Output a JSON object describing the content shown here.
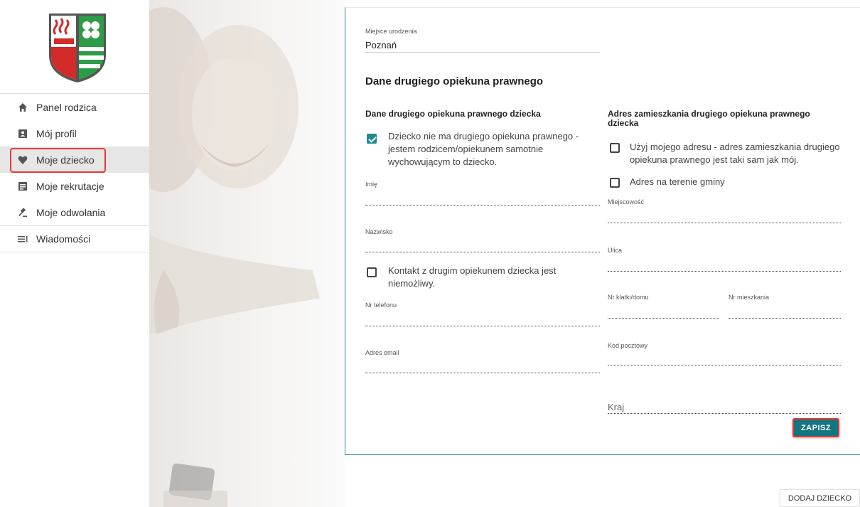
{
  "nav": {
    "items": [
      {
        "label": "Panel rodzica",
        "icon": "home-icon"
      },
      {
        "label": "Mój profil",
        "icon": "id-card-icon"
      },
      {
        "label": "Moje dziecko",
        "icon": "heart-icon"
      },
      {
        "label": "Moje rekrutacje",
        "icon": "document-icon"
      },
      {
        "label": "Moje odwołania",
        "icon": "gavel-icon"
      },
      {
        "label": "Wiadomości",
        "icon": "messages-icon"
      }
    ],
    "active_index": 2
  },
  "form": {
    "birth_place": {
      "label": "Miejsce urodzenia",
      "value": "Poznań"
    },
    "section_title": "Dane drugiego opiekuna prawnego",
    "left": {
      "title": "Dane drugiego opiekuna prawnego dziecka",
      "no_guardian_checkbox": {
        "label": "Dziecko nie ma drugiego opiekuna prawnego - jestem rodzicem/opiekunem samotnie wychowującym to dziecko.",
        "checked": true
      },
      "first_name_label": "Imię",
      "last_name_label": "Nazwisko",
      "no_contact_checkbox": {
        "label": "Kontakt z drugim opiekunem dziecka jest niemożliwy.",
        "checked": false
      },
      "phone_label": "Nr telefonu",
      "email_label": "Adres email"
    },
    "right": {
      "title": "Adres zamieszkania drugiego opiekuna prawnego dziecka",
      "same_address_checkbox": {
        "label": "Użyj mojego adresu - adres zamieszkania drugiego opiekuna prawnego jest taki sam jak mój.",
        "checked": false
      },
      "in_commune_checkbox": {
        "label": "Adres na terenie gminy",
        "checked": false
      },
      "city_label": "Miejscowość",
      "street_label": "Ulica",
      "building_label": "Nr klatki/domu",
      "flat_label": "Nr mieszkania",
      "postal_label": "Kod pocztowy",
      "country_label": "Kraj"
    },
    "save_label": "ZAPISZ"
  },
  "add_child_label": "DODAJ DZIECKO",
  "colors": {
    "accent": "#13757f",
    "highlight": "#e53935",
    "checkbox": "#1e8a95"
  }
}
